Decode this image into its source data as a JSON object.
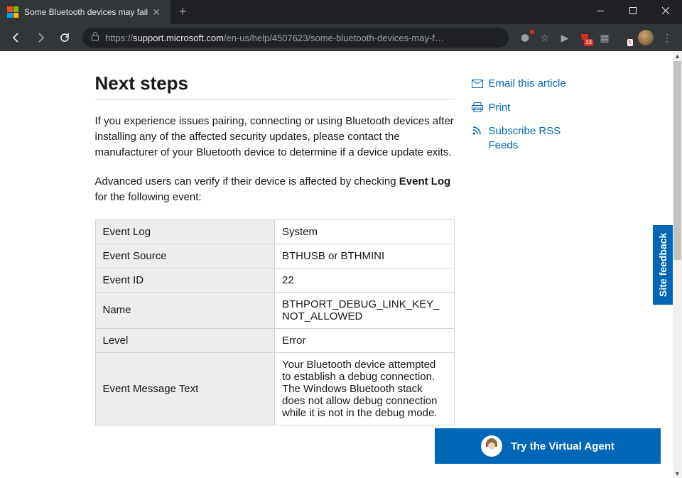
{
  "browser": {
    "tab_title": "Some Bluetooth devices may fail",
    "url_proto": "https://",
    "url_host": "support.microsoft.com",
    "url_path": "/en-us/help/4507623/some-bluetooth-devices-may-f…",
    "ext_badge_1": "33",
    "ext_badge_2": "5"
  },
  "article": {
    "heading": "Next steps",
    "para1": "If you experience issues pairing, connecting or using Bluetooth devices after installing any of the affected security updates, please contact the manufacturer of your Bluetooth device to determine if a device update exits.",
    "para2_a": "Advanced users can verify if their device is affected by checking ",
    "para2_b": "Event Log",
    "para2_c": " for the following event:"
  },
  "table": {
    "r1k": "Event Log",
    "r1v": "System",
    "r2k": "Event Source",
    "r2v": "BTHUSB or BTHMINI",
    "r3k": "Event ID",
    "r3v": "22",
    "r4k": "Name",
    "r4v": "BTHPORT_DEBUG_LINK_KEY_NOT_ALLOWED",
    "r5k": "Level",
    "r5v": "Error",
    "r6k": "Event Message Text",
    "r6v": "Your Bluetooth device attempted to establish a debug connection.  The Windows Bluetooth stack does not allow debug connection while it is not in the debug mode."
  },
  "rail": {
    "email": "Email this article",
    "print": "Print",
    "rss": "Subscribe RSS Feeds"
  },
  "feedback": "Site feedback",
  "virtual_agent": "Try the Virtual Agent"
}
